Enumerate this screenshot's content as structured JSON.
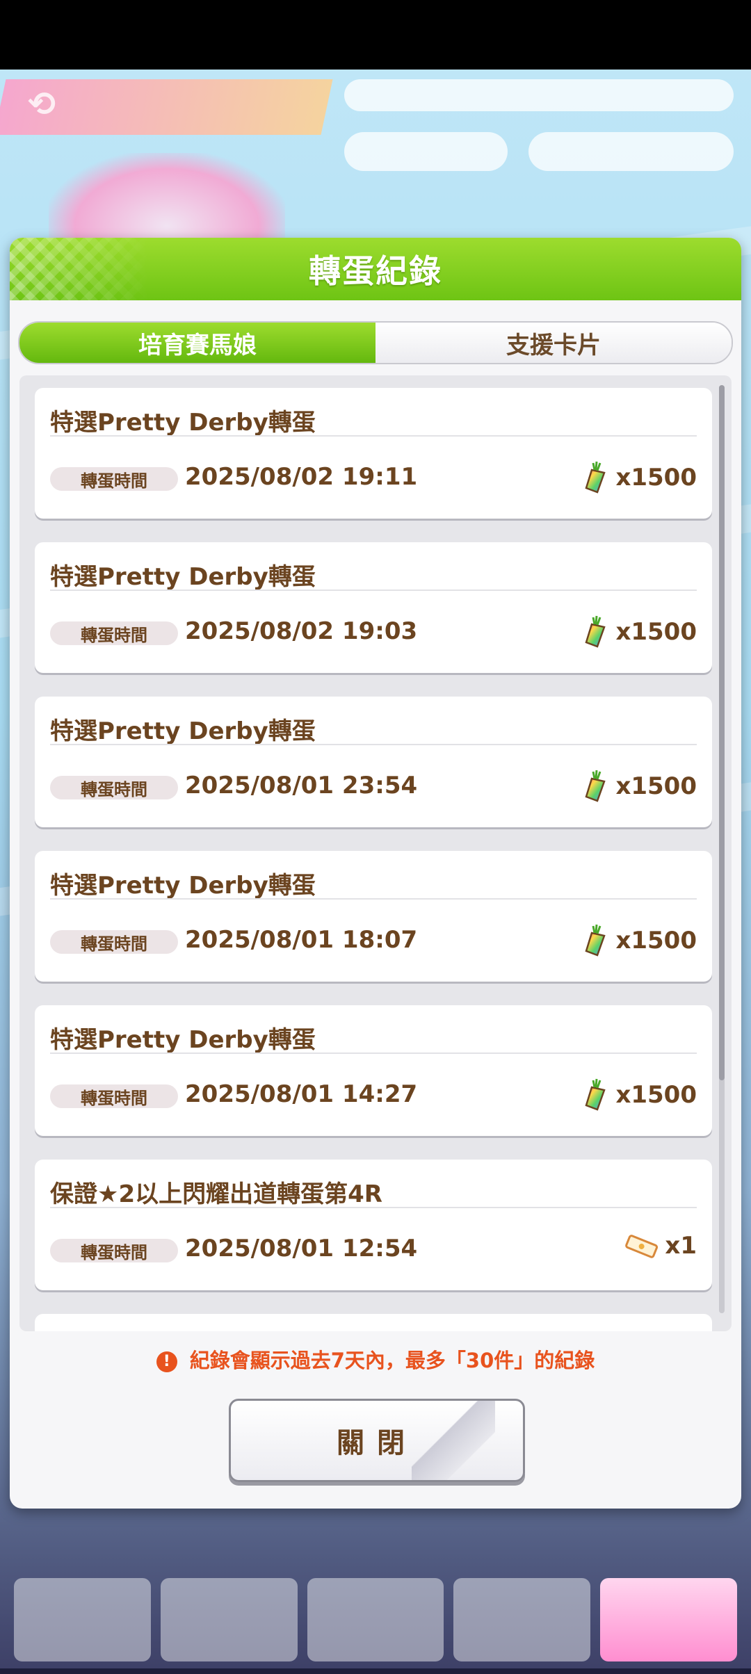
{
  "dialog": {
    "title": "轉蛋紀錄"
  },
  "tabs": [
    {
      "label": "培育賽馬娘",
      "active": true
    },
    {
      "label": "支援卡片",
      "active": false
    }
  ],
  "records": [
    {
      "title": "特選Pretty Derby轉蛋",
      "time_label": "轉蛋時間",
      "time": "2025/08/02 19:11",
      "cost": "x1500",
      "icon": "carat-jewel-icon"
    },
    {
      "title": "特選Pretty Derby轉蛋",
      "time_label": "轉蛋時間",
      "time": "2025/08/02 19:03",
      "cost": "x1500",
      "icon": "carat-jewel-icon"
    },
    {
      "title": "特選Pretty Derby轉蛋",
      "time_label": "轉蛋時間",
      "time": "2025/08/01 23:54",
      "cost": "x1500",
      "icon": "carat-jewel-icon"
    },
    {
      "title": "特選Pretty Derby轉蛋",
      "time_label": "轉蛋時間",
      "time": "2025/08/01 18:07",
      "cost": "x1500",
      "icon": "carat-jewel-icon"
    },
    {
      "title": "特選Pretty Derby轉蛋",
      "time_label": "轉蛋時間",
      "time": "2025/08/01 14:27",
      "cost": "x1500",
      "icon": "carat-jewel-icon"
    },
    {
      "title": "保證★2以上閃耀出道轉蛋第4R",
      "time_label": "轉蛋時間",
      "time": "2025/08/01 12:54",
      "cost": "x1",
      "icon": "ticket-icon"
    }
  ],
  "notice": {
    "text": "紀錄會顯示過去7天內，最多「30件」的紀錄"
  },
  "close_button": {
    "label": "關閉"
  },
  "colors": {
    "header_green": "#6ec414",
    "text_brown": "#6b4420",
    "notice_orange": "#e8531e"
  }
}
